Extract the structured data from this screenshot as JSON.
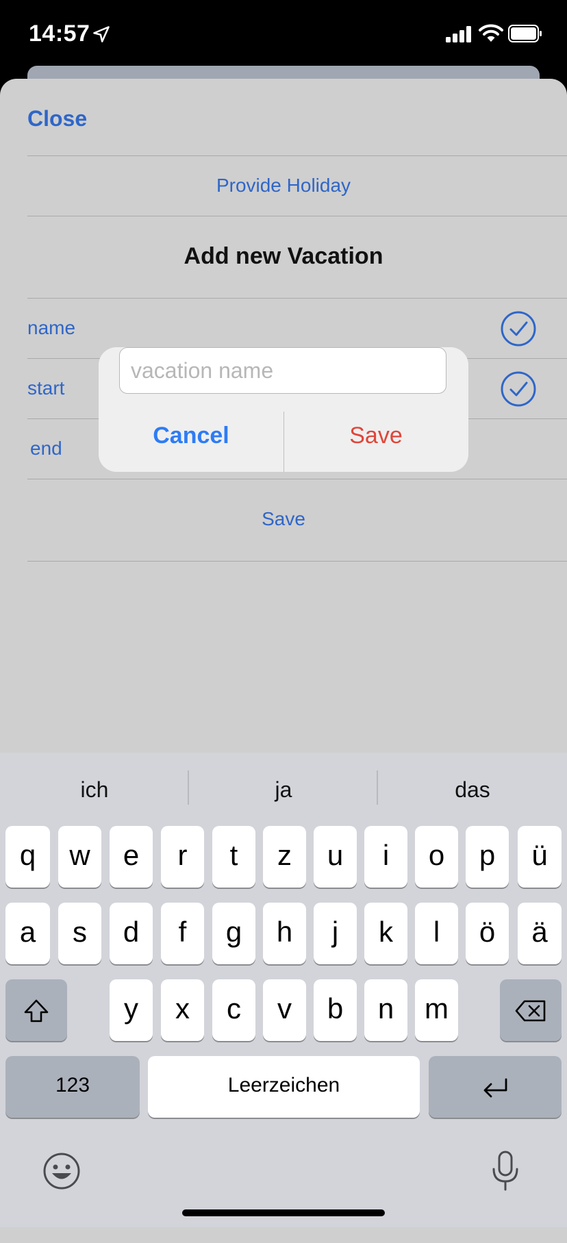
{
  "status_bar": {
    "time": "14:57"
  },
  "sheet": {
    "close_label": "Close",
    "provide_holiday": "Provide Holiday",
    "title": "Add new Vacation",
    "rows": {
      "name": "name",
      "start": "start",
      "end": "end"
    },
    "save_link": "Save"
  },
  "alert": {
    "input_placeholder": "vacation name",
    "input_value": "",
    "cancel_label": "Cancel",
    "save_label": "Save"
  },
  "keyboard": {
    "suggestions": [
      "ich",
      "ja",
      "das"
    ],
    "row1": [
      "q",
      "w",
      "e",
      "r",
      "t",
      "z",
      "u",
      "i",
      "o",
      "p",
      "ü"
    ],
    "row2": [
      "a",
      "s",
      "d",
      "f",
      "g",
      "h",
      "j",
      "k",
      "l",
      "ö",
      "ä"
    ],
    "row3": [
      "y",
      "x",
      "c",
      "v",
      "b",
      "n",
      "m"
    ],
    "numbers_label": "123",
    "space_label": "Leerzeichen"
  },
  "colors": {
    "link_blue": "#2f66c8",
    "alert_blue": "#2d7cf6",
    "alert_red": "#e0463a",
    "sheet_bg": "#cfcfcf",
    "keyboard_bg": "#d2d4da"
  },
  "icons": {
    "location": "location-arrow-icon",
    "signal": "cellular-signal-icon",
    "wifi": "wifi-icon",
    "battery": "battery-icon",
    "check": "checkmark-circle-icon",
    "shift": "shift-icon",
    "delete": "backspace-icon",
    "return": "return-icon",
    "emoji": "emoji-icon",
    "mic": "microphone-icon"
  }
}
